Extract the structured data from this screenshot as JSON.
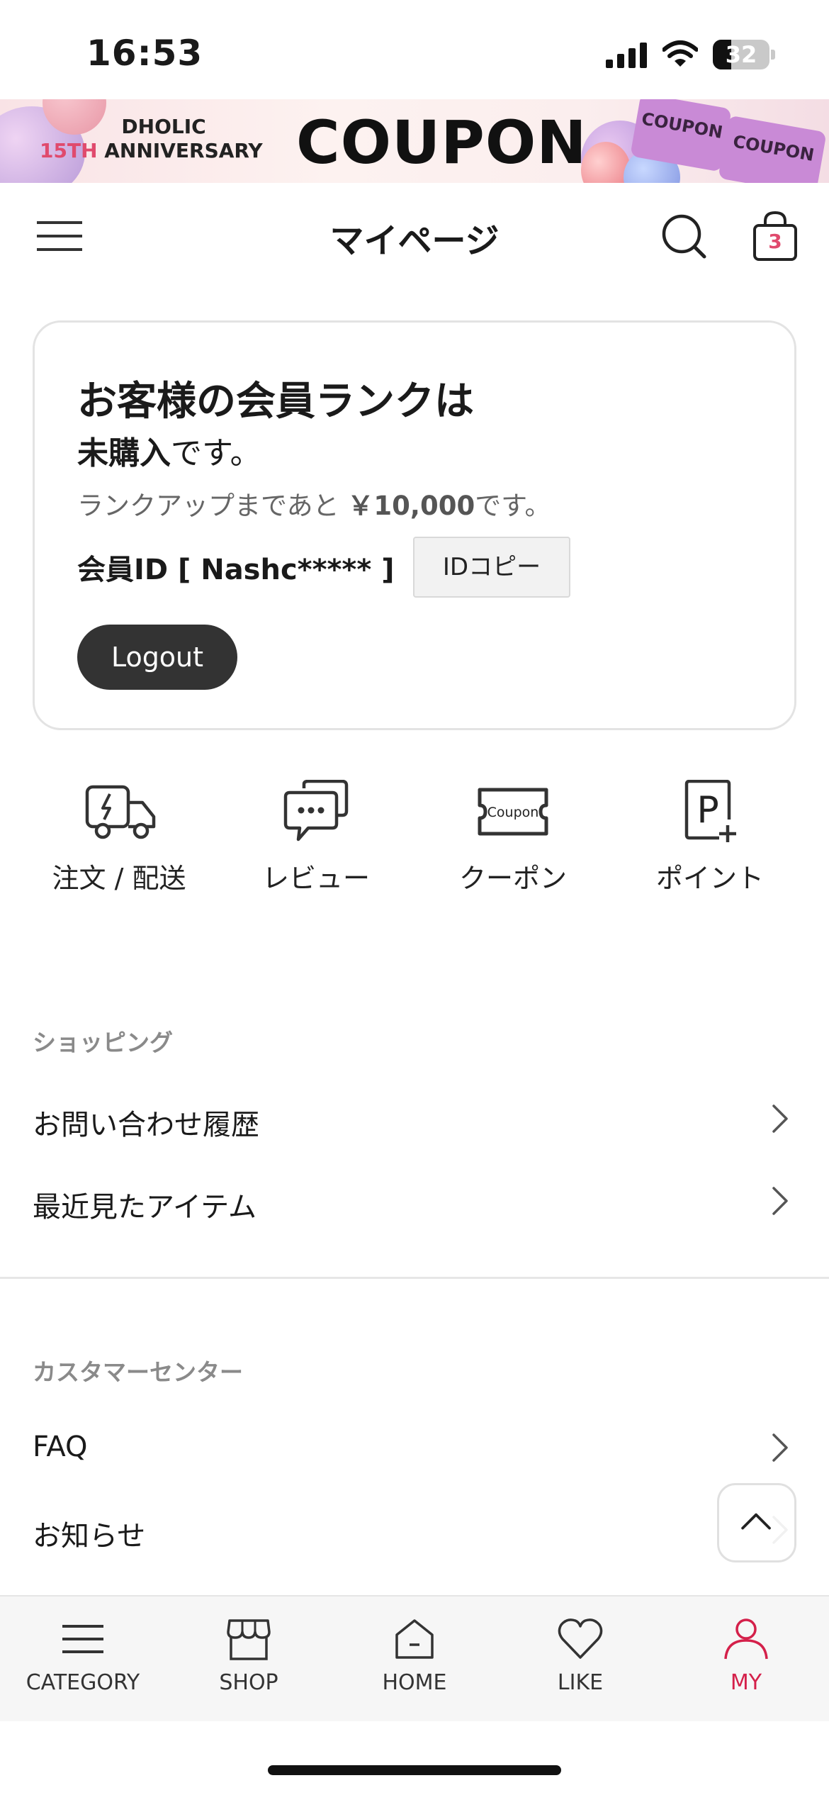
{
  "status_bar": {
    "time": "16:53",
    "battery": "32",
    "battery_level": 0.32
  },
  "banner": {
    "line1": "DHOLIC",
    "anniv_accent": "15TH",
    "anniv_rest": "ANNIVERSARY",
    "title": "COUPON",
    "ticket_text": "COUPON"
  },
  "header": {
    "title": "マイページ",
    "cart_count": "3"
  },
  "rank_card": {
    "title": "お客様の会員ランクは",
    "status_bold": "未購入",
    "status_suffix": "です。",
    "next_prefix": "ランクアップまであと",
    "next_amount": "￥10,000",
    "next_suffix": "です。",
    "member_id": "会員ID [ Nashc***** ]",
    "copy_button": "IDコピー",
    "logout_button": "Logout"
  },
  "quick_menu": {
    "items": [
      {
        "label": "注文 / 配送",
        "icon": "delivery-truck-icon"
      },
      {
        "label": "レビュー",
        "icon": "review-chat-icon"
      },
      {
        "label": "クーポン",
        "icon": "coupon-icon",
        "icon_text": "Coupon"
      },
      {
        "label": "ポイント",
        "icon": "point-icon",
        "icon_text": "P"
      }
    ]
  },
  "shopping": {
    "heading": "ショッピング",
    "items": [
      {
        "label": "お問い合わせ履歴"
      },
      {
        "label": "最近見たアイテム"
      }
    ]
  },
  "customer_center": {
    "heading": "カスタマーセンター",
    "items": [
      {
        "label": "FAQ"
      },
      {
        "label": "お知らせ"
      }
    ]
  },
  "bottom_nav": {
    "active_color": "#d4204a",
    "items": [
      {
        "label": "CATEGORY",
        "icon": "menu-lines-icon"
      },
      {
        "label": "SHOP",
        "icon": "store-icon"
      },
      {
        "label": "HOME",
        "icon": "home-icon"
      },
      {
        "label": "LIKE",
        "icon": "heart-icon"
      },
      {
        "label": "MY",
        "icon": "person-icon"
      }
    ]
  }
}
